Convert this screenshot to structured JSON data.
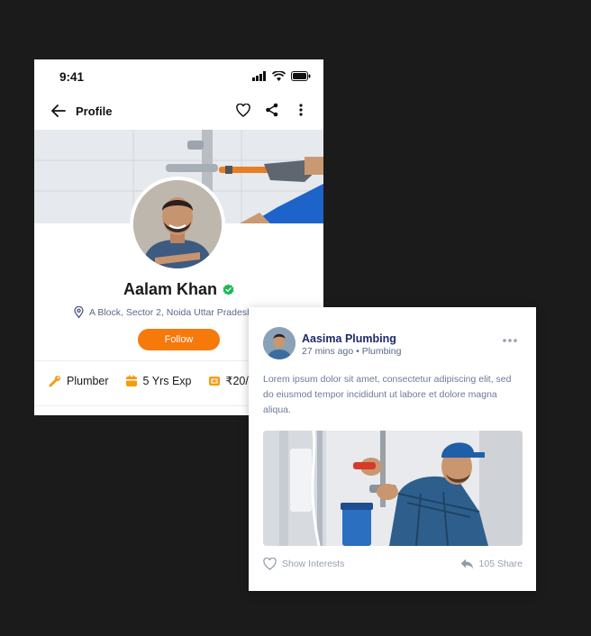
{
  "status_bar": {
    "time": "9:41"
  },
  "nav": {
    "title": "Profile"
  },
  "profile": {
    "name": "Aalam Khan",
    "location": "A Block, Sector 2, Noida Uttar Pradesh",
    "follow_label": "Follow",
    "stats": [
      {
        "label": "Plumber",
        "icon": "wrench-icon",
        "color": "#f39c12"
      },
      {
        "label": "5 Yrs Exp",
        "icon": "calendar-icon",
        "color": "#f39c12"
      },
      {
        "label": "₹20/",
        "icon": "wallet-icon",
        "color": "#f39c12"
      }
    ]
  },
  "post": {
    "author": "Aasima Plumbing",
    "time": "27 mins ago",
    "category": "Plumbing",
    "meta": "27 mins ago • Plumbing",
    "body": "Lorem ipsum dolor sit amet, consectetur adipiscing elit, sed do eiusmod tempor incididunt ut labore et dolore magna aliqua.",
    "interest_label": "Show Interests",
    "share_label": "105 Share"
  },
  "colors": {
    "accent": "#f6790b",
    "verified": "#1db954",
    "author": "#1c2a6b"
  }
}
